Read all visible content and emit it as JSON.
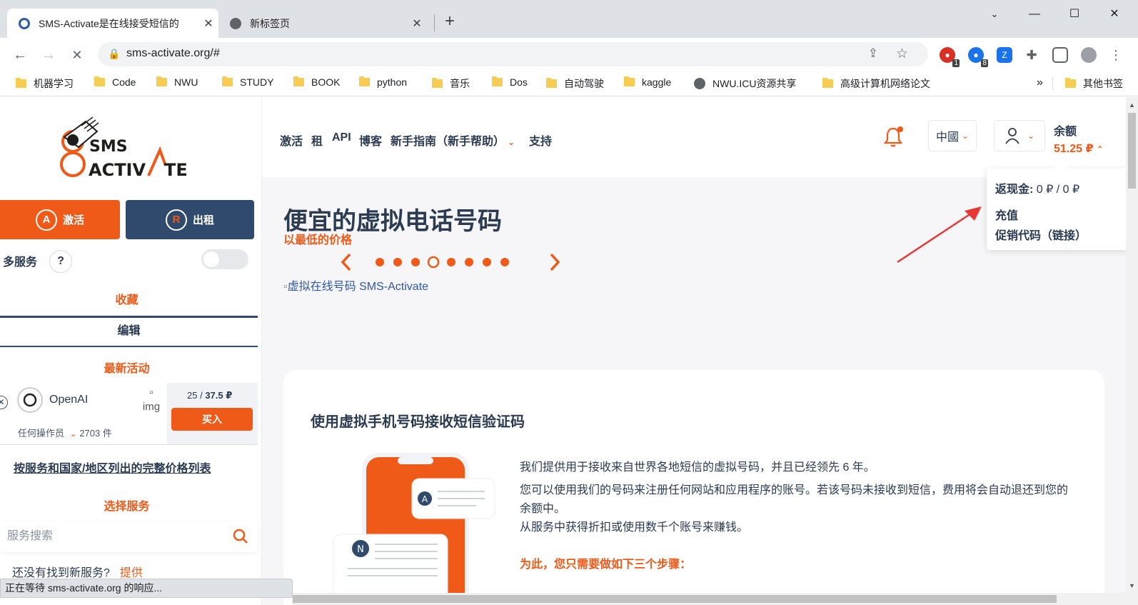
{
  "browser": {
    "tabs": [
      {
        "title": "SMS-Activate是在线接受短信的",
        "active": true
      },
      {
        "title": "新标签页",
        "active": false
      }
    ],
    "url": "sms-activate.org/#",
    "extension_badges": [
      "1",
      "8"
    ],
    "bookmarks": [
      {
        "label": "机器学习",
        "type": "folder"
      },
      {
        "label": "Code",
        "type": "folder"
      },
      {
        "label": "NWU",
        "type": "folder"
      },
      {
        "label": "STUDY",
        "type": "folder"
      },
      {
        "label": "BOOK",
        "type": "folder"
      },
      {
        "label": "python",
        "type": "folder"
      },
      {
        "label": "音乐",
        "type": "folder"
      },
      {
        "label": "Dos",
        "type": "folder"
      },
      {
        "label": "自动驾驶",
        "type": "folder"
      },
      {
        "label": "kaggle",
        "type": "folder"
      },
      {
        "label": "NWU.ICU资源共享",
        "type": "link"
      },
      {
        "label": "高级计算机网络论文",
        "type": "folder"
      }
    ],
    "bookmarks_more": "»",
    "other_bookmarks": "其他书签",
    "status": "正在等待 sms-activate.org 的响应..."
  },
  "sidebar": {
    "activate_label": "激活",
    "rent_label": "出租",
    "multi_service_label": "多服务",
    "help": "?",
    "favorites": "收藏",
    "edit": "编辑",
    "latest_activity": "最新活动",
    "service": {
      "name": "OpenAI",
      "img_alt": "img",
      "price_count": "25",
      "price_value": "37.5 ₽",
      "buy_label": "买入",
      "operator": "任何操作员",
      "stock": "2703 件"
    },
    "price_list_link": "按服务和国家/地区列出的完整价格列表",
    "select_service": "选择服务",
    "search_placeholder": "服务搜索",
    "not_found": "还没有找到新服务?",
    "provide": "提供"
  },
  "header": {
    "nav": [
      "激活",
      "租",
      "API",
      "博客",
      "新手指南（新手帮助）",
      "支持"
    ],
    "country": "中國",
    "balance_label": "余额",
    "balance_value": "51.25 ₽"
  },
  "balance_dropdown": {
    "cashback_label": "返现金:",
    "cashback_value": " 0 ₽ / 0 ₽",
    "topup": "充值",
    "promo": "促销代码（链接）"
  },
  "hero": {
    "title": "便宜的虚拟电话号码",
    "subtitle": "以最低的价格",
    "carousel_dot_count": 8,
    "carousel_active_index": 3,
    "broken_image_alt": "虚拟在线号码 SMS-Activate"
  },
  "card": {
    "title": "使用虚拟手机号码接收短信验证码",
    "para1": "我们提供用于接收来自世界各地短信的虚拟号码，并且已经领先 6 年。",
    "para2": "您可以使用我们的号码来注册任何网站和应用程序的账号。若该号码未接收到短信，费用将会自动退还到您的余额中。",
    "para3": "从服务中获得折扣或使用数千个账号来赚钱。",
    "steps_label": "为此，您只需要做如下三个步骤：",
    "bubble_letters": [
      "A",
      "N"
    ]
  },
  "colors": {
    "brand_orange": "#ef5a18",
    "navy": "#2f4a6d",
    "text": "#2a3b52"
  }
}
